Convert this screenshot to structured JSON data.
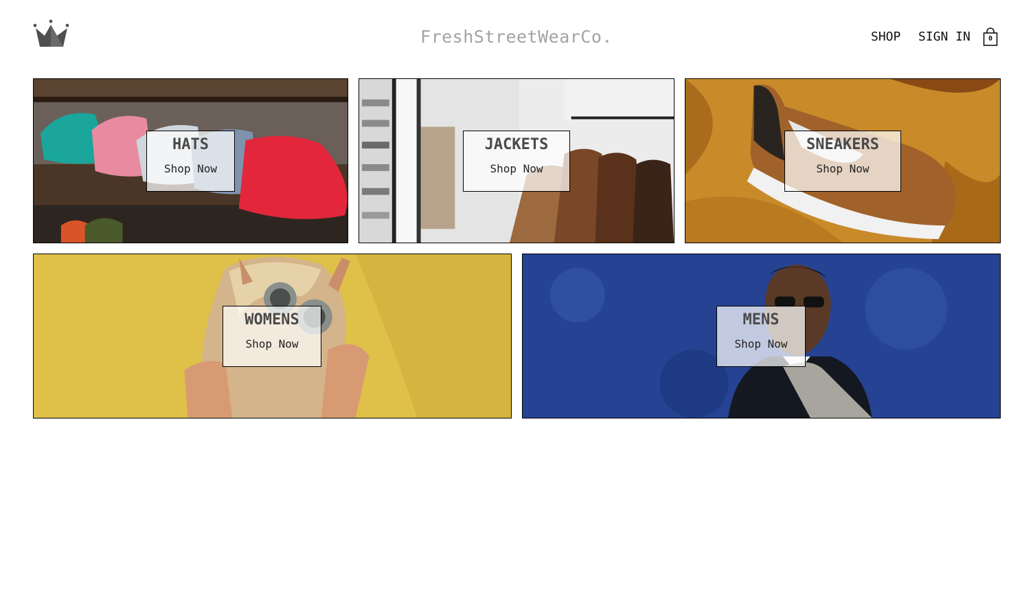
{
  "header": {
    "brand": "FreshStreetWearCo.",
    "logo_icon": "crown-icon",
    "nav": {
      "shop": "SHOP",
      "sign_in": "SIGN IN"
    },
    "cart": {
      "icon": "shopping-bag-icon",
      "count": "0"
    }
  },
  "categories": [
    {
      "title": "HATS",
      "cta": "Shop Now",
      "image": "caps-on-wooden-shelf"
    },
    {
      "title": "JACKETS",
      "cta": "Shop Now",
      "image": "leather-jackets-on-rack"
    },
    {
      "title": "SNEAKERS",
      "cta": "Shop Now",
      "image": "brown-sneaker-on-mustard-fabric"
    },
    {
      "title": "WOMENS",
      "cta": "Shop Now",
      "image": "woman-with-round-sunglasses-yellow-wall"
    },
    {
      "title": "MENS",
      "cta": "Shop Now",
      "image": "man-in-sunglasses-blue-wall"
    }
  ],
  "colors": {
    "brand_text": "#a3a3a3",
    "border": "#000000",
    "label_bg": "rgba(255,255,255,0.72)"
  }
}
